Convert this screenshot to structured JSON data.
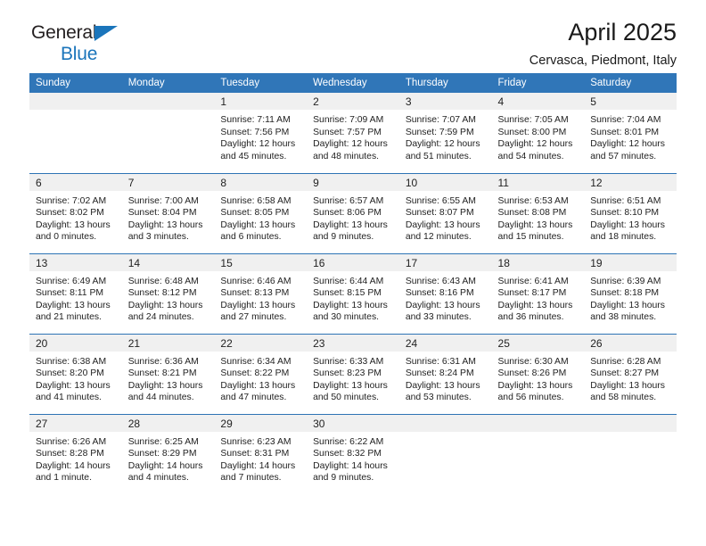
{
  "brand": {
    "name_part1": "General",
    "name_part2": "Blue",
    "accent_color": "#1b75bb"
  },
  "header": {
    "title": "April 2025",
    "subtitle": "Cervasca, Piedmont, Italy"
  },
  "theme": {
    "header_blue": "#3076b8",
    "rule_blue": "#2e74b5",
    "daynum_band": "#f0f0f0"
  },
  "calendar": {
    "weekday_headers": [
      "Sunday",
      "Monday",
      "Tuesday",
      "Wednesday",
      "Thursday",
      "Friday",
      "Saturday"
    ],
    "weeks": [
      [
        {
          "day": "",
          "empty": true
        },
        {
          "day": "",
          "empty": true
        },
        {
          "day": "1",
          "sunrise": "Sunrise: 7:11 AM",
          "sunset": "Sunset: 7:56 PM",
          "daylight": "Daylight: 12 hours and 45 minutes."
        },
        {
          "day": "2",
          "sunrise": "Sunrise: 7:09 AM",
          "sunset": "Sunset: 7:57 PM",
          "daylight": "Daylight: 12 hours and 48 minutes."
        },
        {
          "day": "3",
          "sunrise": "Sunrise: 7:07 AM",
          "sunset": "Sunset: 7:59 PM",
          "daylight": "Daylight: 12 hours and 51 minutes."
        },
        {
          "day": "4",
          "sunrise": "Sunrise: 7:05 AM",
          "sunset": "Sunset: 8:00 PM",
          "daylight": "Daylight: 12 hours and 54 minutes."
        },
        {
          "day": "5",
          "sunrise": "Sunrise: 7:04 AM",
          "sunset": "Sunset: 8:01 PM",
          "daylight": "Daylight: 12 hours and 57 minutes."
        }
      ],
      [
        {
          "day": "6",
          "sunrise": "Sunrise: 7:02 AM",
          "sunset": "Sunset: 8:02 PM",
          "daylight": "Daylight: 13 hours and 0 minutes."
        },
        {
          "day": "7",
          "sunrise": "Sunrise: 7:00 AM",
          "sunset": "Sunset: 8:04 PM",
          "daylight": "Daylight: 13 hours and 3 minutes."
        },
        {
          "day": "8",
          "sunrise": "Sunrise: 6:58 AM",
          "sunset": "Sunset: 8:05 PM",
          "daylight": "Daylight: 13 hours and 6 minutes."
        },
        {
          "day": "9",
          "sunrise": "Sunrise: 6:57 AM",
          "sunset": "Sunset: 8:06 PM",
          "daylight": "Daylight: 13 hours and 9 minutes."
        },
        {
          "day": "10",
          "sunrise": "Sunrise: 6:55 AM",
          "sunset": "Sunset: 8:07 PM",
          "daylight": "Daylight: 13 hours and 12 minutes."
        },
        {
          "day": "11",
          "sunrise": "Sunrise: 6:53 AM",
          "sunset": "Sunset: 8:08 PM",
          "daylight": "Daylight: 13 hours and 15 minutes."
        },
        {
          "day": "12",
          "sunrise": "Sunrise: 6:51 AM",
          "sunset": "Sunset: 8:10 PM",
          "daylight": "Daylight: 13 hours and 18 minutes."
        }
      ],
      [
        {
          "day": "13",
          "sunrise": "Sunrise: 6:49 AM",
          "sunset": "Sunset: 8:11 PM",
          "daylight": "Daylight: 13 hours and 21 minutes."
        },
        {
          "day": "14",
          "sunrise": "Sunrise: 6:48 AM",
          "sunset": "Sunset: 8:12 PM",
          "daylight": "Daylight: 13 hours and 24 minutes."
        },
        {
          "day": "15",
          "sunrise": "Sunrise: 6:46 AM",
          "sunset": "Sunset: 8:13 PM",
          "daylight": "Daylight: 13 hours and 27 minutes."
        },
        {
          "day": "16",
          "sunrise": "Sunrise: 6:44 AM",
          "sunset": "Sunset: 8:15 PM",
          "daylight": "Daylight: 13 hours and 30 minutes."
        },
        {
          "day": "17",
          "sunrise": "Sunrise: 6:43 AM",
          "sunset": "Sunset: 8:16 PM",
          "daylight": "Daylight: 13 hours and 33 minutes."
        },
        {
          "day": "18",
          "sunrise": "Sunrise: 6:41 AM",
          "sunset": "Sunset: 8:17 PM",
          "daylight": "Daylight: 13 hours and 36 minutes."
        },
        {
          "day": "19",
          "sunrise": "Sunrise: 6:39 AM",
          "sunset": "Sunset: 8:18 PM",
          "daylight": "Daylight: 13 hours and 38 minutes."
        }
      ],
      [
        {
          "day": "20",
          "sunrise": "Sunrise: 6:38 AM",
          "sunset": "Sunset: 8:20 PM",
          "daylight": "Daylight: 13 hours and 41 minutes."
        },
        {
          "day": "21",
          "sunrise": "Sunrise: 6:36 AM",
          "sunset": "Sunset: 8:21 PM",
          "daylight": "Daylight: 13 hours and 44 minutes."
        },
        {
          "day": "22",
          "sunrise": "Sunrise: 6:34 AM",
          "sunset": "Sunset: 8:22 PM",
          "daylight": "Daylight: 13 hours and 47 minutes."
        },
        {
          "day": "23",
          "sunrise": "Sunrise: 6:33 AM",
          "sunset": "Sunset: 8:23 PM",
          "daylight": "Daylight: 13 hours and 50 minutes."
        },
        {
          "day": "24",
          "sunrise": "Sunrise: 6:31 AM",
          "sunset": "Sunset: 8:24 PM",
          "daylight": "Daylight: 13 hours and 53 minutes."
        },
        {
          "day": "25",
          "sunrise": "Sunrise: 6:30 AM",
          "sunset": "Sunset: 8:26 PM",
          "daylight": "Daylight: 13 hours and 56 minutes."
        },
        {
          "day": "26",
          "sunrise": "Sunrise: 6:28 AM",
          "sunset": "Sunset: 8:27 PM",
          "daylight": "Daylight: 13 hours and 58 minutes."
        }
      ],
      [
        {
          "day": "27",
          "sunrise": "Sunrise: 6:26 AM",
          "sunset": "Sunset: 8:28 PM",
          "daylight": "Daylight: 14 hours and 1 minute."
        },
        {
          "day": "28",
          "sunrise": "Sunrise: 6:25 AM",
          "sunset": "Sunset: 8:29 PM",
          "daylight": "Daylight: 14 hours and 4 minutes."
        },
        {
          "day": "29",
          "sunrise": "Sunrise: 6:23 AM",
          "sunset": "Sunset: 8:31 PM",
          "daylight": "Daylight: 14 hours and 7 minutes."
        },
        {
          "day": "30",
          "sunrise": "Sunrise: 6:22 AM",
          "sunset": "Sunset: 8:32 PM",
          "daylight": "Daylight: 14 hours and 9 minutes."
        },
        {
          "day": "",
          "empty": true
        },
        {
          "day": "",
          "empty": true
        },
        {
          "day": "",
          "empty": true
        }
      ]
    ]
  }
}
